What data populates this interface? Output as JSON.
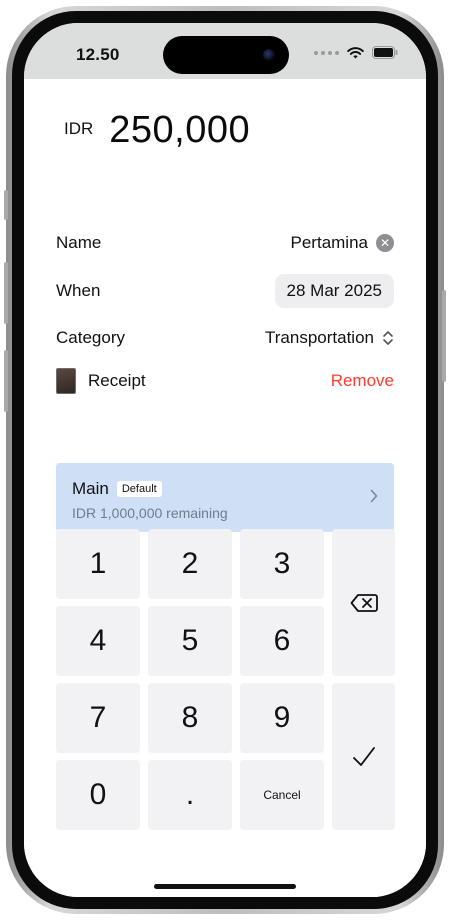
{
  "status_bar": {
    "time": "12.50",
    "icons": [
      "signal-dots-icon",
      "wifi-icon",
      "battery-icon"
    ]
  },
  "amount": {
    "currency": "IDR",
    "value": "250,000"
  },
  "fields": {
    "name": {
      "label": "Name",
      "value": "Pertamina"
    },
    "when": {
      "label": "When",
      "value": "28 Mar 2025"
    },
    "category": {
      "label": "Category",
      "value": "Transportation"
    },
    "receipt": {
      "label": "Receipt",
      "action": "Remove"
    }
  },
  "budget": {
    "name": "Main",
    "badge": "Default",
    "remaining": "IDR 1,000,000 remaining"
  },
  "keypad": {
    "keys": [
      "1",
      "2",
      "3",
      "4",
      "5",
      "6",
      "7",
      "8",
      "9",
      "0",
      "."
    ],
    "cancel": "Cancel",
    "backspace_icon": "delete-left-icon",
    "confirm_icon": "checkmark-icon"
  },
  "colors": {
    "destructive": "#ff3b30",
    "budget_bg": "#cfe0f6",
    "key_bg": "#f2f2f4"
  }
}
